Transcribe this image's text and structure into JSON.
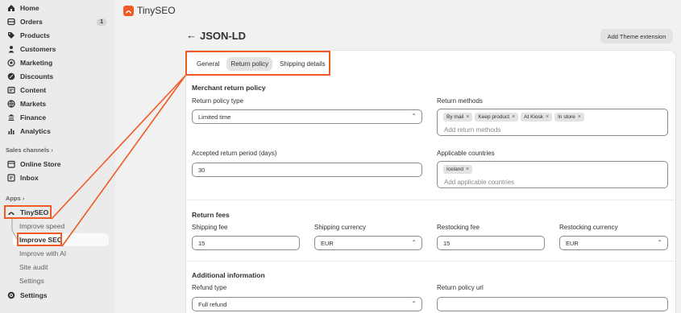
{
  "sidebar": {
    "nav": [
      {
        "label": "Home",
        "icon": "home-icon"
      },
      {
        "label": "Orders",
        "icon": "orders-icon",
        "badge": "1"
      },
      {
        "label": "Products",
        "icon": "tag-icon"
      },
      {
        "label": "Customers",
        "icon": "person-icon"
      },
      {
        "label": "Marketing",
        "icon": "target-icon"
      },
      {
        "label": "Discounts",
        "icon": "discount-icon"
      },
      {
        "label": "Content",
        "icon": "content-icon"
      },
      {
        "label": "Markets",
        "icon": "globe-icon"
      },
      {
        "label": "Finance",
        "icon": "bank-icon"
      },
      {
        "label": "Analytics",
        "icon": "bar-chart-icon"
      }
    ],
    "sales_channels_label": "Sales channels",
    "channels": [
      {
        "label": "Online Store",
        "icon": "store-icon"
      },
      {
        "label": "Inbox",
        "icon": "inbox-icon"
      }
    ],
    "apps_label": "Apps",
    "app": {
      "label": "TinySEO",
      "icon": "tinyseo-icon"
    },
    "app_subitems": [
      "Improve speed",
      "Improve SEO",
      "Improve with AI",
      "Site audit",
      "Settings"
    ],
    "settings_label": "Settings"
  },
  "app_header": {
    "title": "TinySEO"
  },
  "page": {
    "title": "JSON-LD",
    "action_button": "Add Theme extension",
    "tabs": [
      "General",
      "Return policy",
      "Shipping details"
    ],
    "active_tab": "Return policy"
  },
  "merchant": {
    "heading": "Merchant return policy",
    "policy_type_label": "Return policy type",
    "policy_type_value": "Limited time",
    "methods_label": "Return methods",
    "methods_chips": [
      "By mail",
      "Keep product",
      "At Kiosk",
      "In store"
    ],
    "methods_placeholder": "Add return methods",
    "period_label": "Accepted return period (days)",
    "period_value": "30",
    "countries_label": "Applicable countries",
    "countries_chips": [
      "Iceland"
    ],
    "countries_placeholder": "Add applicable countries"
  },
  "fees": {
    "heading": "Return fees",
    "shipping_fee_label": "Shipping fee",
    "shipping_fee_value": "15",
    "shipping_currency_label": "Shipping currency",
    "shipping_currency_value": "EUR",
    "restocking_fee_label": "Restocking fee",
    "restocking_fee_value": "15",
    "restocking_currency_label": "Restocking currency",
    "restocking_currency_value": "EUR"
  },
  "additional": {
    "heading": "Additional information",
    "refund_type_label": "Refund type",
    "refund_type_value": "Full refund",
    "policy_url_label": "Return policy url",
    "policy_url_value": ""
  },
  "colors": {
    "accent": "#f15a24",
    "sidebar_bg": "#ebebeb",
    "page_bg": "#f1f1f1"
  }
}
